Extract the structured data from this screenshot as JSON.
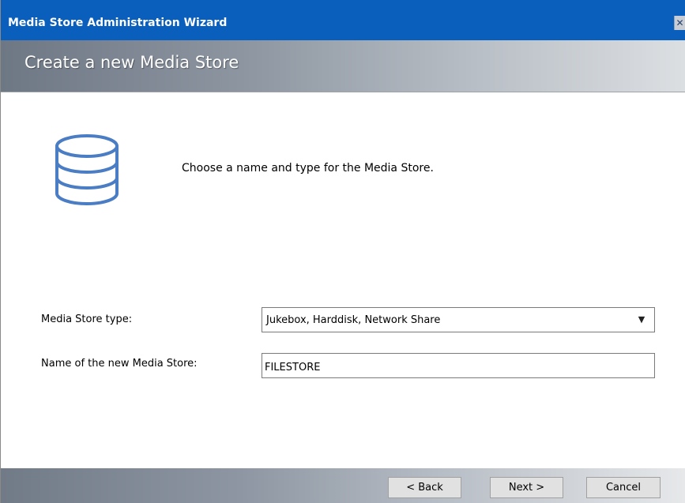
{
  "window": {
    "title": "Media Store Administration Wizard",
    "close_glyph": "✕"
  },
  "header": {
    "title": "Create a new Media Store"
  },
  "content": {
    "icon": "database-icon",
    "intro": "Choose a name and type for the Media Store."
  },
  "form": {
    "type_label": "Media Store type:",
    "type_value": "Jukebox, Harddisk, Network Share",
    "name_label": "Name of the new Media Store:",
    "name_value": "FILESTORE"
  },
  "buttons": {
    "back": "< Back",
    "next": "Next >",
    "cancel": "Cancel"
  },
  "colors": {
    "titlebar": "#0a5fbd",
    "icon_blue": "#4a7dc4"
  }
}
